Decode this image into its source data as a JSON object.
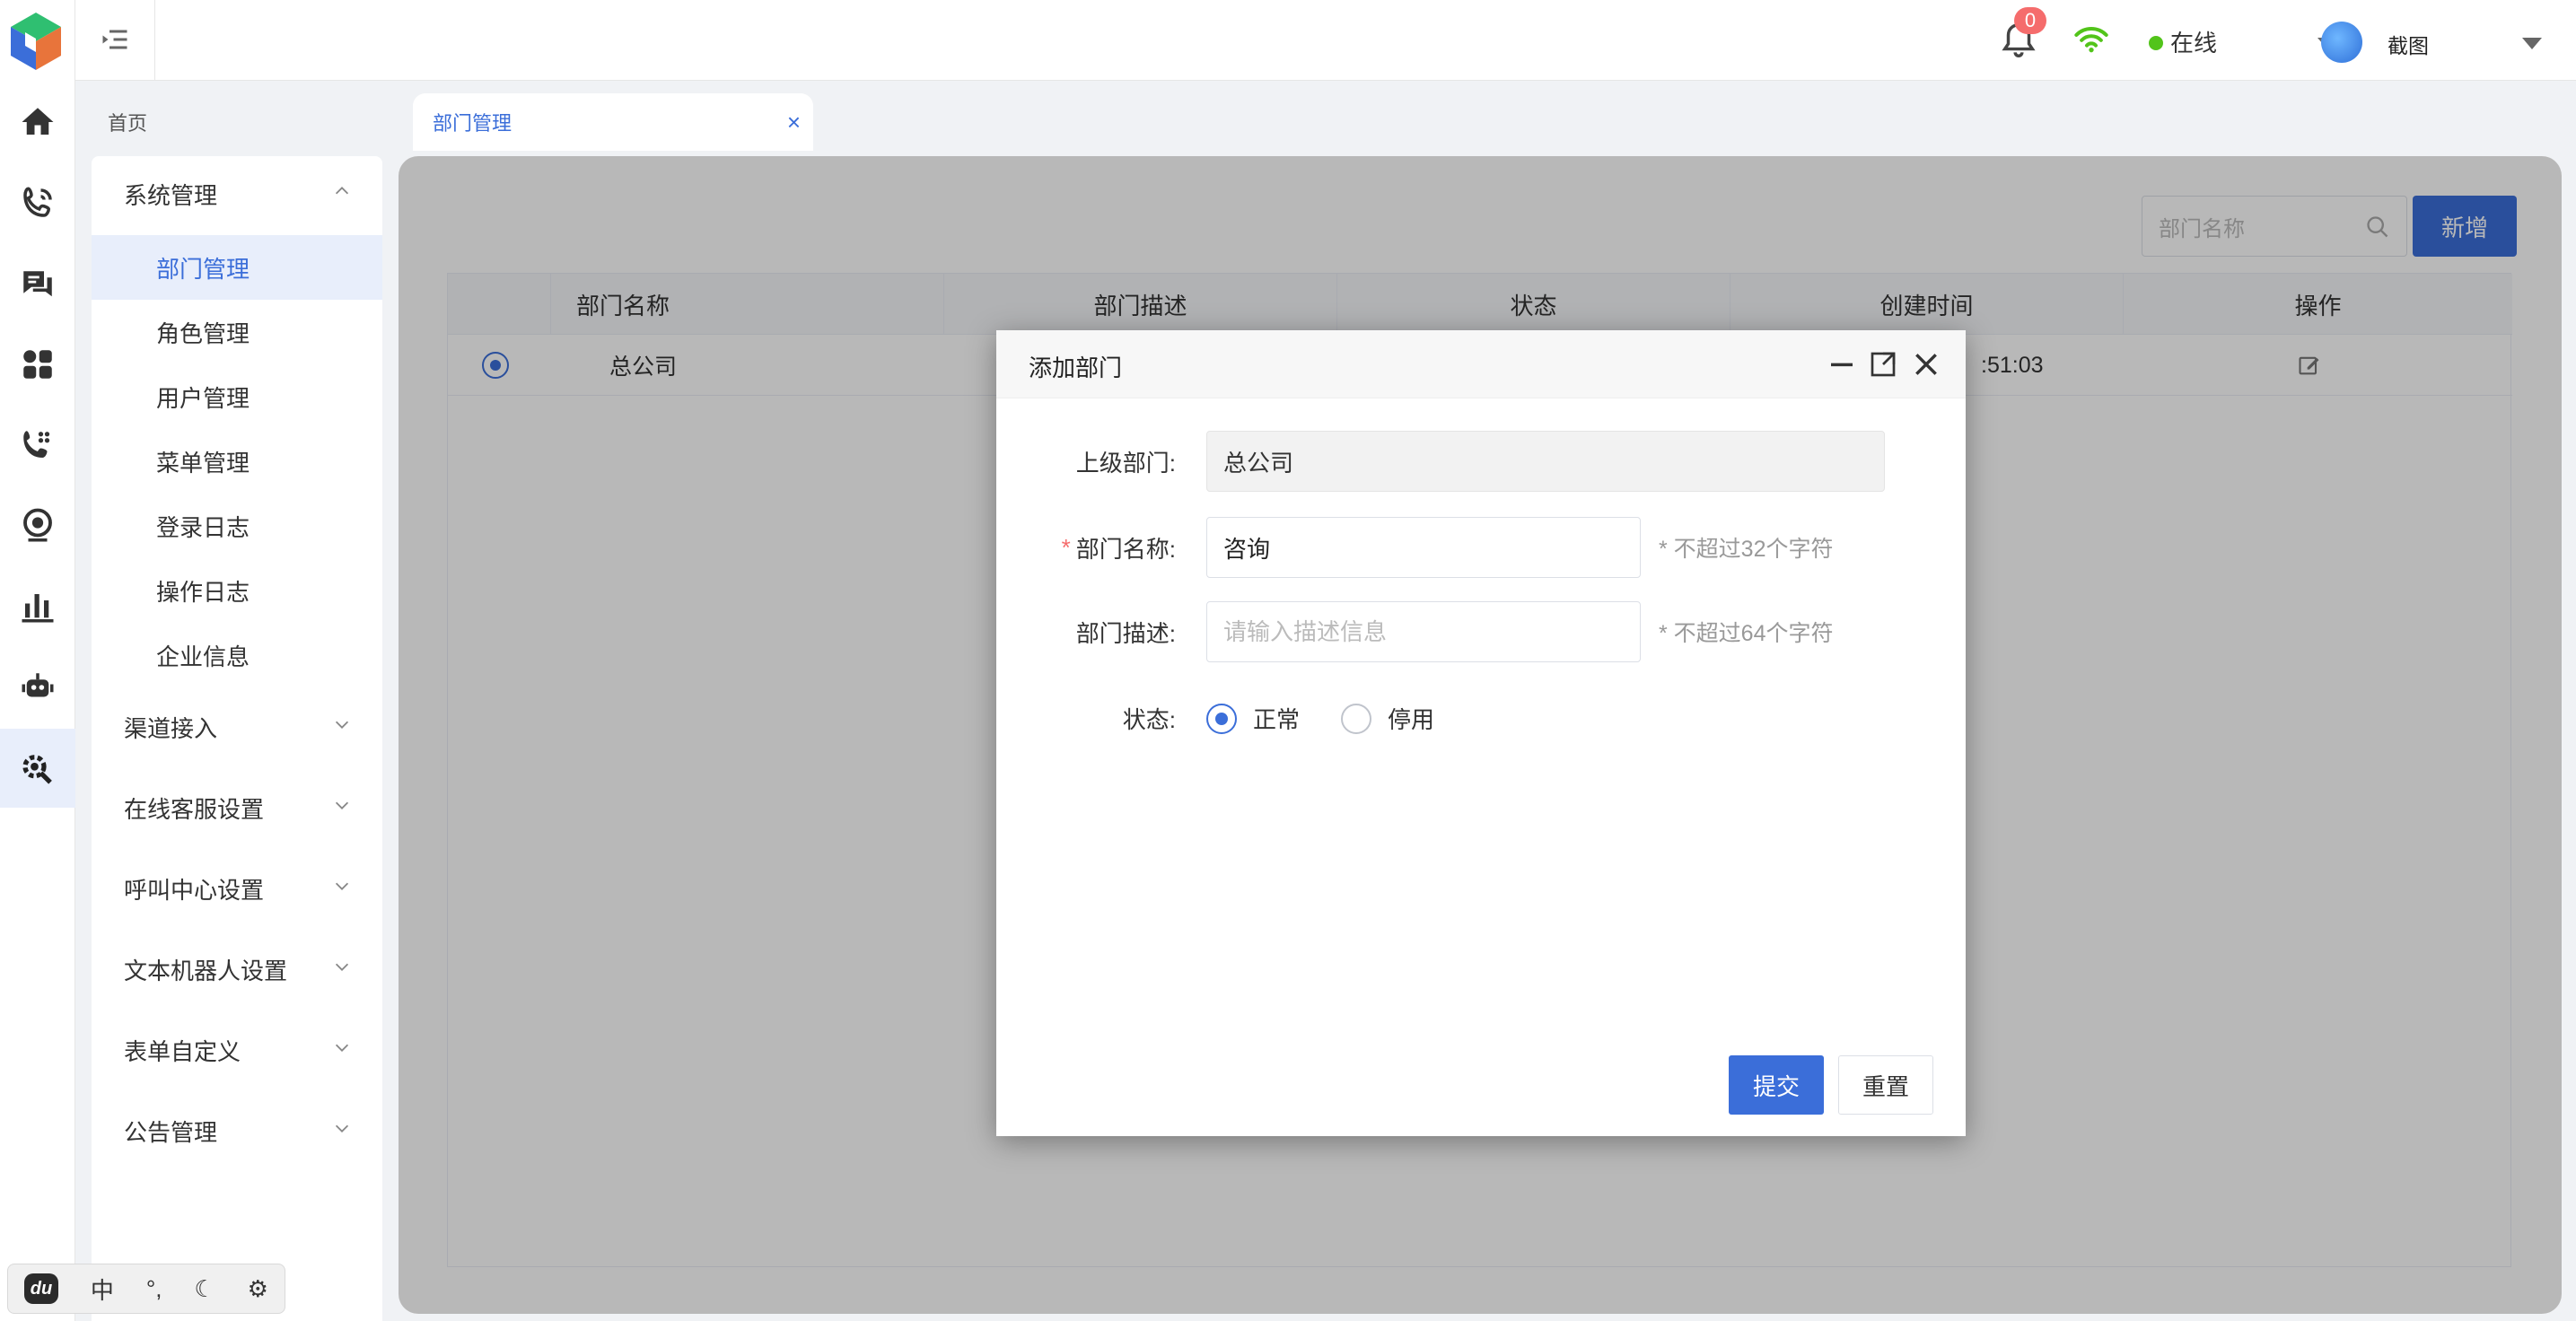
{
  "header": {
    "notification_count": "0",
    "status_label": "在线",
    "username": "截图"
  },
  "icons": {
    "logo": "app-logo-cube",
    "collapse": "menu-collapse-icon",
    "bell": "bell-icon",
    "wifi": "wifi-icon",
    "avatar": "user-avatar"
  },
  "rail": {
    "items": [
      "home-icon",
      "call-icon",
      "chat-icon",
      "apps-icon",
      "phone-settings-icon",
      "camera-icon",
      "chart-icon",
      "robot-icon",
      "system-settings-icon"
    ],
    "active_index": 8
  },
  "tabs": [
    {
      "label": "首页",
      "close": "×"
    },
    {
      "label": "部门管理",
      "close": "×"
    }
  ],
  "menu": {
    "groups": [
      {
        "label": "系统管理",
        "expanded": true
      },
      {
        "label": "渠道接入"
      },
      {
        "label": "在线客服设置"
      },
      {
        "label": "呼叫中心设置"
      },
      {
        "label": "文本机器人设置"
      },
      {
        "label": "表单自定义"
      },
      {
        "label": "公告管理"
      }
    ],
    "system_items": [
      "部门管理",
      "角色管理",
      "用户管理",
      "菜单管理",
      "登录日志",
      "操作日志",
      "企业信息"
    ],
    "active_item": "部门管理"
  },
  "toolbar": {
    "search_placeholder": "部门名称",
    "add_label": "新增"
  },
  "table": {
    "columns": [
      "部门名称",
      "部门描述",
      "状态",
      "创建时间",
      "操作"
    ],
    "rows": [
      {
        "name": "总公司",
        "created_partial": ":51:03"
      }
    ]
  },
  "dialog": {
    "title": "添加部门",
    "parent_label": "上级部门:",
    "parent_value": "总公司",
    "name_label": "部门名称:",
    "name_value": "咨询",
    "name_hint": "* 不超过32个字符",
    "desc_label": "部门描述:",
    "desc_placeholder": "请输入描述信息",
    "desc_hint": "* 不超过64个字符",
    "status_label": "状态:",
    "status_options": [
      "正常",
      "停用"
    ],
    "status_selected": "正常",
    "submit_label": "提交",
    "reset_label": "重置"
  },
  "ime": {
    "logo": "du",
    "lang": "中",
    "punct": "°,",
    "moon": "☾",
    "gear": "⚙"
  },
  "colors": {
    "primary": "#3b6ed9",
    "online": "#52c41a",
    "badge": "#f56c6c"
  }
}
